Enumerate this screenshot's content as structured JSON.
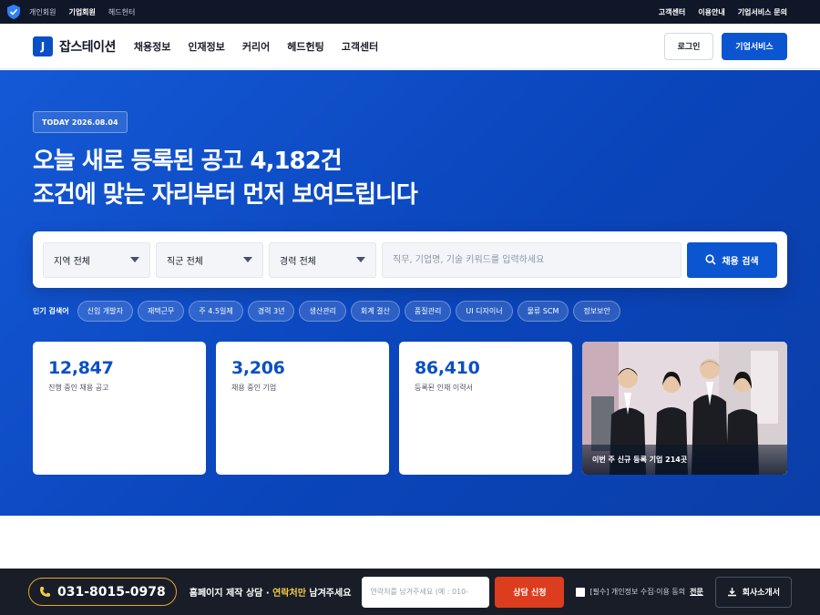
{
  "utilbar": {
    "shield_text": "개인정보 안심",
    "links": [
      "개인회원",
      "기업회원",
      "헤드헌터"
    ],
    "active_index": 1,
    "right_links": [
      "고객센터",
      "이용안내",
      "기업서비스 문의"
    ]
  },
  "header": {
    "logo_mark": "J",
    "logo_text": "잡스테이션",
    "nav": [
      "채용정보",
      "인재정보",
      "커리어",
      "헤드헌팅",
      "고객센터"
    ],
    "login_label": "로그인",
    "biz_label": "기업서비스"
  },
  "hero": {
    "today": "TODAY 2026.08.04",
    "headline_1": "오늘 새로 등록된 공고 4,182건",
    "headline_2": "조건에 맞는 자리부터 먼저 보여드립니다",
    "search": {
      "region": "지역 전체",
      "job": "직군 전체",
      "career": "경력 전체",
      "placeholder": "직무, 기업명, 기술 키워드를 입력하세요",
      "button": "채용 검색"
    },
    "popular_label": "인기 검색어",
    "popular": [
      "신입 개발자",
      "재택근무",
      "주 4.5일제",
      "경력 3년",
      "생산관리",
      "회계 결산",
      "품질관리",
      "UI 디자이너",
      "물류 SCM",
      "정보보안"
    ],
    "stats": [
      {
        "value": "12,847",
        "label": "진행 중인 채용 공고"
      },
      {
        "value": "3,206",
        "label": "채용 중인 기업"
      },
      {
        "value": "86,410",
        "label": "등록된 인재 이력서"
      }
    ],
    "photo_caption": "이번 주 신규 등록 기업 214곳"
  },
  "bottombar": {
    "phone": "031-8015-0978",
    "consult_prefix": "홈페이지 제작 상담 · ",
    "consult_highlight": "연락처만",
    "consult_suffix": " 남겨주세요",
    "input_placeholder": "연락처를 남겨주세요 (예 : 010-",
    "apply": "상담 신청",
    "agree_text": "[필수] 개인정보 수집·이용 동의",
    "agree_link": "전문",
    "intro": "회사소개서"
  },
  "colors": {
    "primary": "#0b55d0",
    "hero_bg": "#0a45bb",
    "accent_orange": "#dd3d1f",
    "phone_border": "#e4a72d",
    "dark_bar": "#181d27"
  }
}
